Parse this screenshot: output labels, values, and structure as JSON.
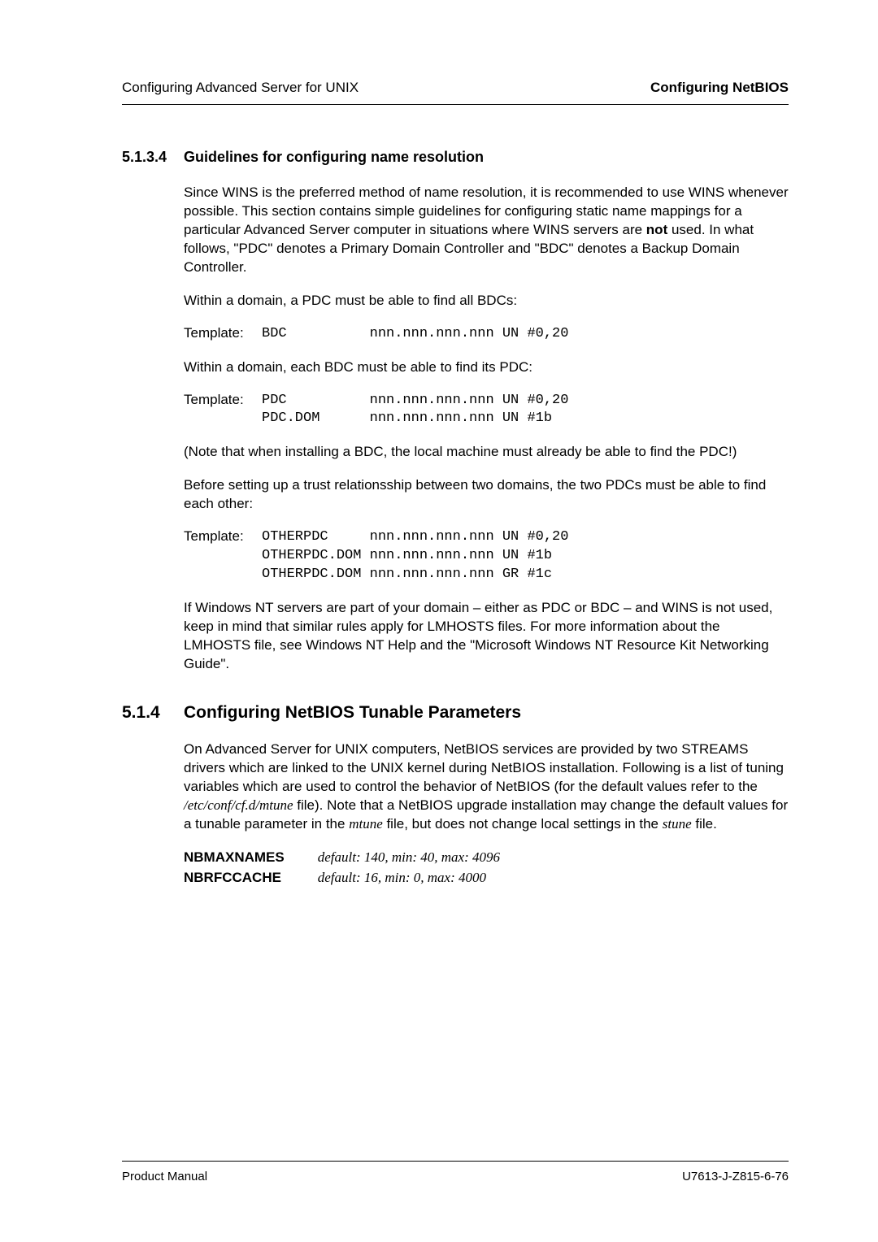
{
  "header": {
    "left": "Configuring Advanced Server for UNIX",
    "right": "Configuring NetBIOS"
  },
  "sec1": {
    "num": "5.1.3.4",
    "title": "Guidelines for configuring name resolution",
    "p1a": "Since WINS is the preferred method of name resolution, it is recommended to use WINS whenever possible. This section contains simple guidelines for configuring static name mappings for a particular Advanced Server computer in situations where WINS servers are ",
    "p1b": "not",
    "p1c": " used. In what follows, \"PDC\" denotes a Primary Domain Controller and \"BDC\" denotes a Backup Domain Controller.",
    "p2": "Within a domain, a PDC must be able to find all BDCs:",
    "tmpl1_label": "Template:",
    "tmpl1_body": "BDC          nnn.nnn.nnn.nnn UN #0,20",
    "p3": "Within a domain, each BDC must be able to find its PDC:",
    "tmpl2_label": "Template:",
    "tmpl2_body": "PDC          nnn.nnn.nnn.nnn UN #0,20\nPDC.DOM      nnn.nnn.nnn.nnn UN #1b",
    "p4": "(Note that when installing a BDC, the local machine must already be able to find the PDC!)",
    "p5": "Before setting up a trust relationsship between two domains, the two PDCs must be able to find each other:",
    "tmpl3_label": "Template:",
    "tmpl3_body": "OTHERPDC     nnn.nnn.nnn.nnn UN #0,20\nOTHERPDC.DOM nnn.nnn.nnn.nnn UN #1b\nOTHERPDC.DOM nnn.nnn.nnn.nnn GR #1c",
    "p6": "If Windows NT servers are part of your domain – either as PDC or BDC – and WINS is not used, keep in mind that similar rules apply for LMHOSTS files. For more information about the LMHOSTS file, see Windows NT Help and the \"Microsoft Windows NT Resource Kit Networking Guide\"."
  },
  "sec2": {
    "num": "5.1.4",
    "title": "Configuring NetBIOS Tunable Parameters",
    "p1a": "On Advanced Server for UNIX computers, NetBIOS services are provided by two STREAMS drivers which are linked to the UNIX kernel during NetBIOS installation. Following is a list of tuning variables which are used to control  the behavior of NetBIOS (for the default values refer to the ",
    "p1_em1": "/etc/conf/cf.d/mtune",
    "p1b": " file). Note that a NetBIOS upgrade installation may change the default values for a tunable parameter in the ",
    "p1_em2": "mtune",
    "p1c": " file, but does not change local settings in the ",
    "p1_em3": "stune",
    "p1d": " file.",
    "defs": [
      {
        "term": "NBMAXNAMES",
        "desc": "default: 140, min: 40, max: 4096"
      },
      {
        "term": "NBRFCCACHE",
        "desc": "default: 16, min: 0, max: 4000"
      }
    ]
  },
  "footer": {
    "left": "Product Manual",
    "right": "U7613-J-Z815-6-76"
  }
}
